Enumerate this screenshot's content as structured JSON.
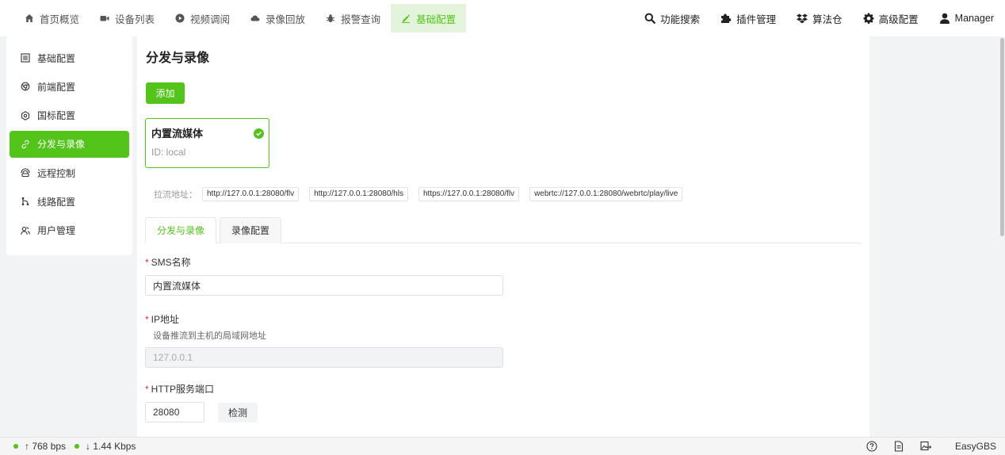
{
  "nav": {
    "items": [
      {
        "label": "首页概览",
        "icon": "home-icon"
      },
      {
        "label": "设备列表",
        "icon": "video-camera-icon"
      },
      {
        "label": "视频调阅",
        "icon": "play-circle-icon"
      },
      {
        "label": "录像回放",
        "icon": "cloud-icon"
      },
      {
        "label": "报警查询",
        "icon": "bug-icon"
      },
      {
        "label": "基础配置",
        "icon": "edit-icon"
      }
    ],
    "active_index": 5
  },
  "tools": {
    "search": "功能搜索",
    "plugins": "插件管理",
    "algorithm": "算法仓",
    "advanced": "高级配置",
    "user": "Manager"
  },
  "sidebar": {
    "items": [
      {
        "label": "基础配置"
      },
      {
        "label": "前端配置"
      },
      {
        "label": "国标配置"
      },
      {
        "label": "分发与录像"
      },
      {
        "label": "远程控制"
      },
      {
        "label": "线路配置"
      },
      {
        "label": "用户管理"
      }
    ],
    "active_index": 3
  },
  "main": {
    "title": "分发与录像",
    "add_label": "添加",
    "card": {
      "title": "内置流媒体",
      "id": "ID: local"
    },
    "pull_label": "拉流地址：",
    "urls": [
      "http://127.0.0.1:28080/flv",
      "http://127.0.0.1:28080/hls",
      "https://127.0.0.1:28080/flv",
      "webrtc://127.0.0.1:28080/webrtc/play/live"
    ],
    "tabs": [
      {
        "label": "分发与录像"
      },
      {
        "label": "录像配置"
      }
    ],
    "form": {
      "sms_name": {
        "label": "SMS名称",
        "value": "内置流媒体"
      },
      "ip": {
        "label": "IP地址",
        "hint": "设备推流到主机的局域网地址",
        "value": "127.0.0.1"
      },
      "http_port": {
        "label": "HTTP服务端口",
        "value": "28080",
        "check_label": "检测"
      }
    }
  },
  "status": {
    "up": "↑ 768 bps",
    "down": "↓ 1.44 Kbps",
    "brand": "EasyGBS"
  },
  "colors": {
    "accent": "#52c41a",
    "accent_light": "#e4f4dc",
    "required": "#f5222d"
  }
}
